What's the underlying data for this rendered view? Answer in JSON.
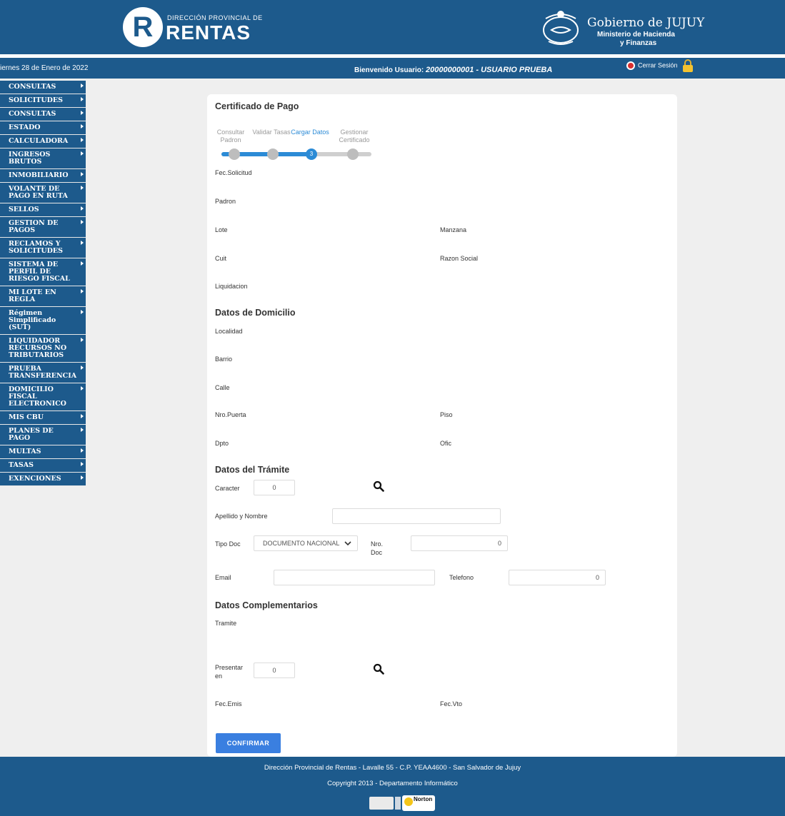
{
  "header": {
    "logo_letter": "R",
    "logo_super": "DIRECCIÓN PROVINCIAL DE",
    "logo_main": "RENTAS",
    "gov_title": "Gobierno de JUJUY",
    "gov_sub1": "Ministerio de Hacienda",
    "gov_sub2": "y Finanzas"
  },
  "infobar": {
    "date": "iernes 28 de Enero de 2022",
    "welcome_prefix": "Bienvenido Usuario: ",
    "welcome_user": "20000000001 - USUARIO PRUEBA",
    "logout_label": "Cerrar Sesión"
  },
  "sidebar": {
    "items": [
      {
        "label": "CONSULTAS"
      },
      {
        "label": "SOLICITUDES"
      },
      {
        "label": "CONSULTAS"
      },
      {
        "label": "ESTADO"
      },
      {
        "label": "CALCULADORA"
      },
      {
        "label": "INGRESOS BRUTOS"
      },
      {
        "label": "INMOBILIARIO"
      },
      {
        "label": "VOLANTE DE PAGO EN RUTA"
      },
      {
        "label": "SELLOS"
      },
      {
        "label": "GESTION DE PAGOS"
      },
      {
        "label": "RECLAMOS Y SOLICITUDES"
      },
      {
        "label": "SISTEMA DE PERFIL DE RIESGO FISCAL"
      },
      {
        "label": "MI LOTE EN REGLA"
      },
      {
        "label": "Régimen Simplificado (SUT)"
      },
      {
        "label": "LIQUIDADOR RECURSOS NO TRIBUTARIOS"
      },
      {
        "label": "PRUEBA TRANSFERENCIA"
      },
      {
        "label": "DOMICILIO FISCAL ELECTRONICO"
      },
      {
        "label": "MIS CBU"
      },
      {
        "label": "PLANES DE PAGO"
      },
      {
        "label": "MULTAS"
      },
      {
        "label": "TASAS"
      },
      {
        "label": "EXENCIONES"
      }
    ]
  },
  "form": {
    "title": "Certificado de Pago",
    "steps": [
      {
        "label": "Consultar Padron",
        "number": ""
      },
      {
        "label": "Validar Tasas",
        "number": ""
      },
      {
        "label": "Cargar Datos",
        "number": "3"
      },
      {
        "label": "Gestionar Certificado",
        "number": ""
      }
    ],
    "current_step": 3,
    "labels": {
      "fec_solicitud": "Fec.Solicitud",
      "padron": "Padron",
      "lote": "Lote",
      "manzana": "Manzana",
      "cuit": "Cuit",
      "razon_social": "Razon Social",
      "liquidacion": "Liquidacion",
      "localidad": "Localidad",
      "barrio": "Barrio",
      "calle": "Calle",
      "nro_puerta": "Nro.Puerta",
      "piso": "Piso",
      "dpto": "Dpto",
      "ofic": "Ofic",
      "caracter": "Caracter",
      "apellido_nombre": "Apellido y Nombre",
      "tipo_doc": "Tipo Doc",
      "nro_doc": "Nro. Doc",
      "email": "Email",
      "telefono": "Telefono",
      "tramite": "Tramite",
      "presentar_en": "Presentar en",
      "fec_emis": "Fec.Emis",
      "fec_vto": "Fec.Vto"
    },
    "sections": {
      "domicilio": "Datos de Domicilio",
      "tramite": "Datos del Trámite",
      "complementarios": "Datos Complementarios"
    },
    "values": {
      "caracter": "0",
      "apellido_nombre": "",
      "tipo_doc": "DOCUMENTO NACIONAL",
      "nro_doc": "0",
      "email": "",
      "telefono": "0",
      "presentar_en": "0"
    },
    "confirm_label": "CONFIRMAR"
  },
  "footer": {
    "line1": "Dirección Provincial de Rentas - Lavalle 55 - C.P. YEAA4600 - San Salvador de Jujuy",
    "line2": "Copyright 2013 - Departamento Informático",
    "badge_norton": "Norton"
  },
  "colors": {
    "brand_blue": "#1d5a8c",
    "accent": "#2c8bd6",
    "button": "#3a7fe0"
  }
}
